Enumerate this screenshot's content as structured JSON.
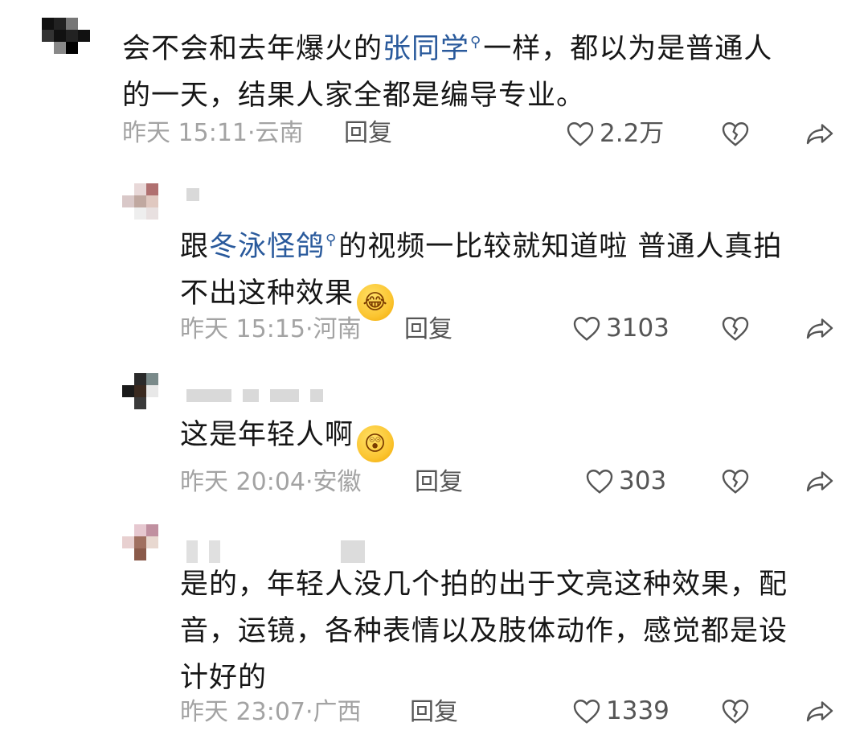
{
  "comments": [
    {
      "text_before": "会不会和去年爆火的",
      "link": "张同学",
      "text_after_line1": "一样，都以为是普通人",
      "line2": "的一天，结果人家全都是编导专业。",
      "time": "昨天 15:11",
      "location": "云南",
      "reply_label": "回复",
      "likes": "2.2万"
    },
    {
      "text_before": "跟",
      "link": "冬泳怪鸽",
      "text_after_line1": "的视频一比较就知道啦 普通人真拍",
      "line2": "不出这种效果",
      "emoji": "rofl-emoji",
      "time": "昨天 15:15",
      "location": "河南",
      "reply_label": "回复",
      "likes": "3103"
    },
    {
      "line1": "这是年轻人啊",
      "emoji": "astonished-emoji",
      "time": "昨天 20:04",
      "location": "安徽",
      "reply_label": "回复",
      "likes": "303"
    },
    {
      "line1": "是的，年轻人没几个拍的出于文亮这种效果，配",
      "line2": "音，运镜，各种表情以及肢体动作，感觉都是设",
      "line3": "计好的",
      "time": "昨天 23:07",
      "location": "广西",
      "reply_label": "回复",
      "likes": "1339"
    }
  ],
  "colors": {
    "link": "#2a5a9c",
    "meta": "#a3a3a3",
    "action": "#555555"
  },
  "icons": [
    "heart-outline-icon",
    "broken-heart-icon",
    "share-arrow-icon"
  ]
}
